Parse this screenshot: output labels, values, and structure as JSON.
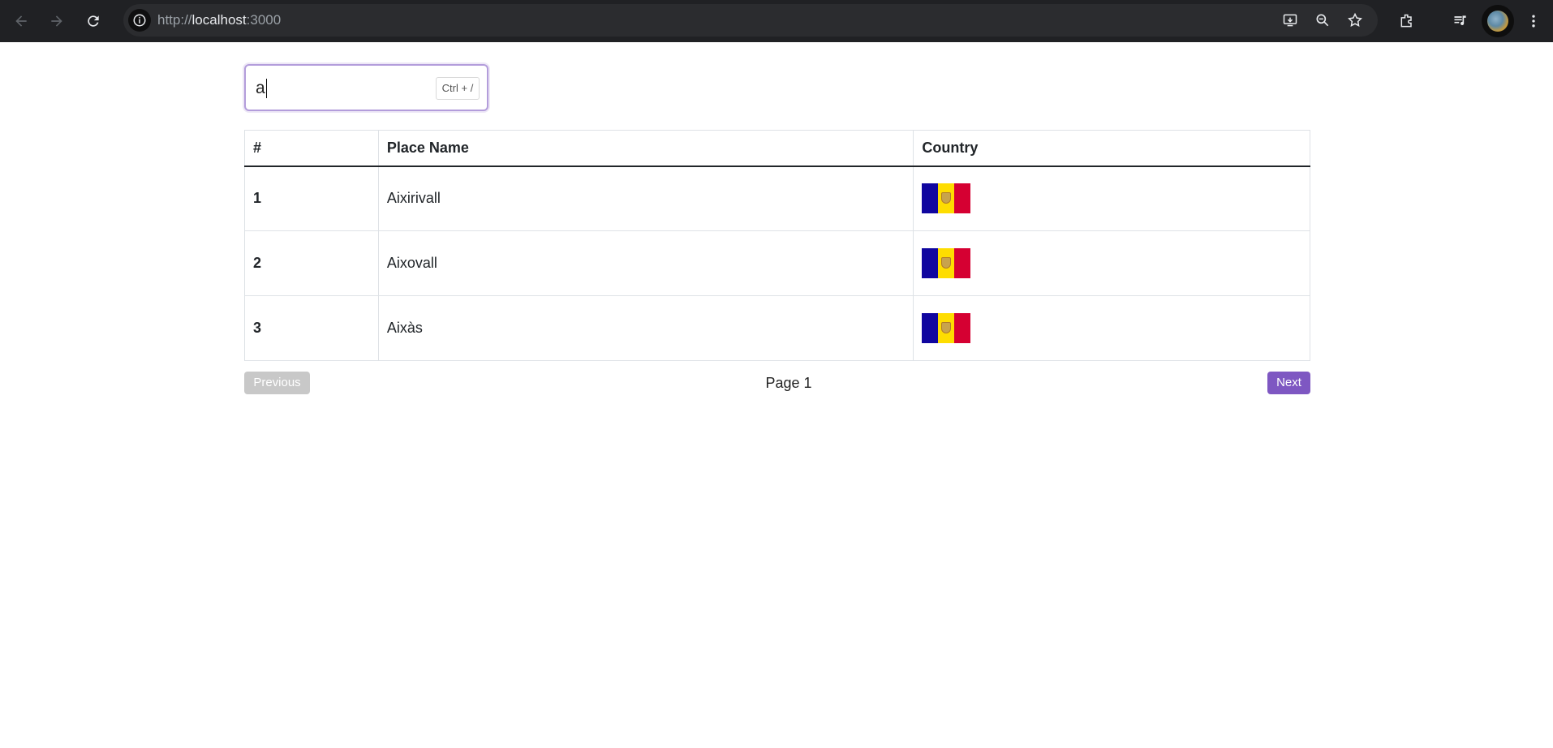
{
  "browser": {
    "url_scheme": "http://",
    "url_host": "localhost",
    "url_port": ":3000"
  },
  "search": {
    "value": "a",
    "shortcut_hint": "Ctrl + /"
  },
  "table": {
    "headers": [
      "#",
      "Place Name",
      "Country"
    ],
    "rows": [
      {
        "num": "1",
        "place": "Aixirivall",
        "country_flag": "andorra-flag-icon"
      },
      {
        "num": "2",
        "place": "Aixovall",
        "country_flag": "andorra-flag-icon"
      },
      {
        "num": "3",
        "place": "Aixàs",
        "country_flag": "andorra-flag-icon"
      }
    ]
  },
  "pagination": {
    "previous_label": "Previous",
    "page_label": "Page 1",
    "next_label": "Next"
  },
  "colors": {
    "accent": "#7e57c2",
    "disabled": "#c8c8c8",
    "chrome_bg": "#202124"
  }
}
